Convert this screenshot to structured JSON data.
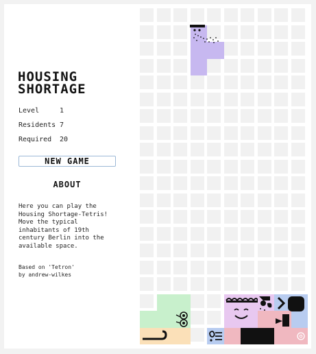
{
  "game": {
    "title_line1": "HOUSING",
    "title_line2": "SHORTAGE"
  },
  "stats": {
    "level_label": "Level",
    "level_value": "1",
    "residents_label": "Residents",
    "residents_value": "7",
    "required_label": "Required",
    "required_value": "20"
  },
  "buttons": {
    "new_game": "NEW GAME",
    "about": "ABOUT"
  },
  "description": "Here you can play the\nHousing Shortage-Tetris!\nMove the typical\ninhabitants of 19th\ncentury Berlin into the\navailable space.",
  "credit": "Based on 'Tetron'\nby andrew-wilkes",
  "colors": {
    "purple": "#c7b8f0",
    "green": "#c8f0cc",
    "peach": "#fbe0b8",
    "pink": "#f0b8c0",
    "lilac": "#e8c8f0",
    "blue": "#b8ccf0",
    "cell": "#f1f1f1"
  }
}
